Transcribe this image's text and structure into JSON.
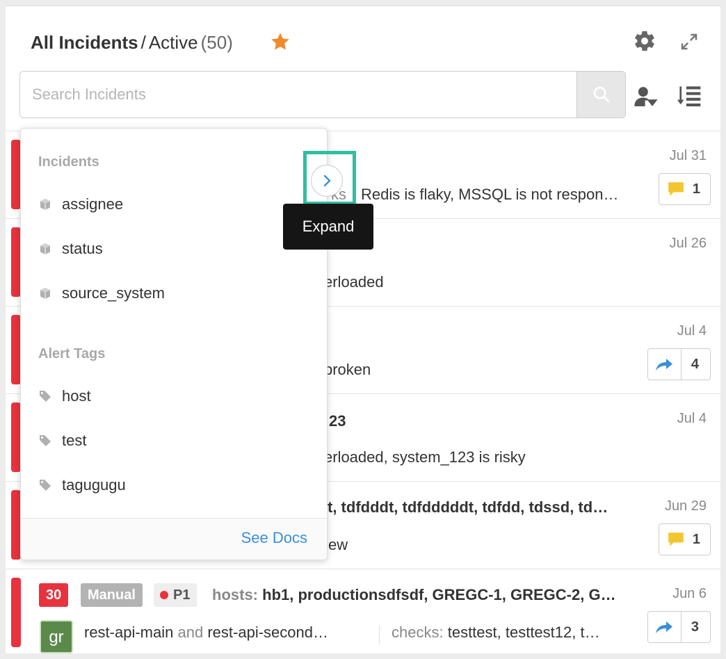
{
  "header": {
    "title_main": "All Incidents",
    "title_sep": "/",
    "title_view": "Active",
    "title_count": "(50)"
  },
  "search": {
    "placeholder": "Search Incidents"
  },
  "colors": {
    "accent_star": "#f08a2c",
    "critical": "#e8323e",
    "link": "#3a8fd9",
    "highlight": "#2fbfa0"
  },
  "incidents": [
    {
      "date": "Jul 31",
      "line2_suffix": "ks",
      "line2": "Redis is flaky,  MSSQL is not respon…",
      "badge_icon": "comment-icon",
      "badge_count": "1"
    },
    {
      "date": "Jul 26",
      "line2": "erloaded"
    },
    {
      "date": "Jul 4",
      "line2": "broken",
      "badge_icon": "share-icon",
      "badge_count": "4"
    },
    {
      "date": "Jul 4",
      "line1": "23",
      "line2": "erloaded,  system_123 is risky"
    },
    {
      "date": "Jun 29",
      "line1": "t,  tdfdddt,  tdfdddddt,  tdfdd,  tdssd,  td…",
      "line2": "ew",
      "badge_icon": "comment-icon",
      "badge_count": "1"
    },
    {
      "date": "Jun 6",
      "tags": {
        "count": "30",
        "source": "Manual",
        "priority": "P1"
      },
      "hosts_label": "hosts:",
      "hosts": "hb1,  productionsdfsdf,  GREGC-1,  GREGC-2,  G…",
      "avatar": "gr",
      "service_main": "rest-api-main",
      "service_and": "and",
      "service_second": "rest-api-second…",
      "checks_label": "checks:",
      "checks": "testtest,  testtest12,  t…",
      "badge_icon": "share-icon",
      "badge_count": "3"
    }
  ],
  "dropdown": {
    "section_incidents": "Incidents",
    "incident_fields": [
      "assignee",
      "status",
      "source_system"
    ],
    "section_tags": "Alert Tags",
    "tag_fields": [
      "host",
      "test",
      "tagugugu"
    ],
    "see_docs": "See Docs",
    "expand_tooltip": "Expand"
  }
}
